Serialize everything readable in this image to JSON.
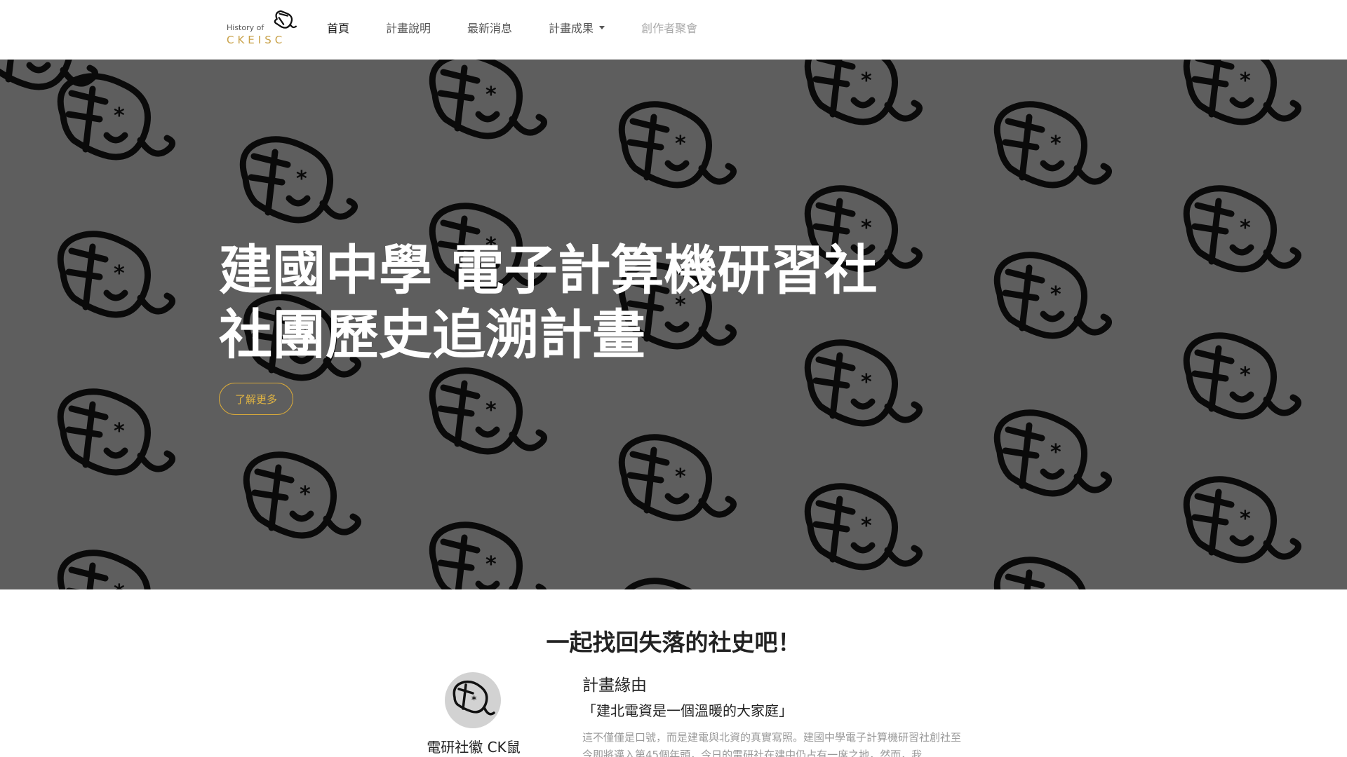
{
  "brand": {
    "history_label": "History of",
    "name": "CKEISC",
    "logo_icon": "ck-mouse-logo-icon"
  },
  "nav": {
    "items": [
      {
        "label": "首頁",
        "state": "active"
      },
      {
        "label": "計畫說明",
        "state": "normal"
      },
      {
        "label": "最新消息",
        "state": "normal"
      },
      {
        "label": "計畫成果",
        "state": "dropdown"
      },
      {
        "label": "創作者聚會",
        "state": "disabled"
      }
    ]
  },
  "hero": {
    "title_line1": "建國中學  電子計算機研習社",
    "title_line2": "社團歷史追溯計畫",
    "button_label": "了解更多",
    "background_color": "#5e5e5e",
    "pattern_icon": "ck-mouse-pattern-icon",
    "accent_color": "#d8a93a"
  },
  "section": {
    "title": "一起找回失落的社史吧！",
    "badge_caption": "電研社徽 CK鼠",
    "reason_title": "計畫緣由",
    "reason_quote": "「建北電資是一個溫暖的大家庭」",
    "reason_body": "這不僅僅是口號，而是建電與北資的真實寫照。建國中學電子計算機研習社創社至今即將邁入第45個年頭，今日的電研社在建中仍占有一席之地，然而，我"
  }
}
